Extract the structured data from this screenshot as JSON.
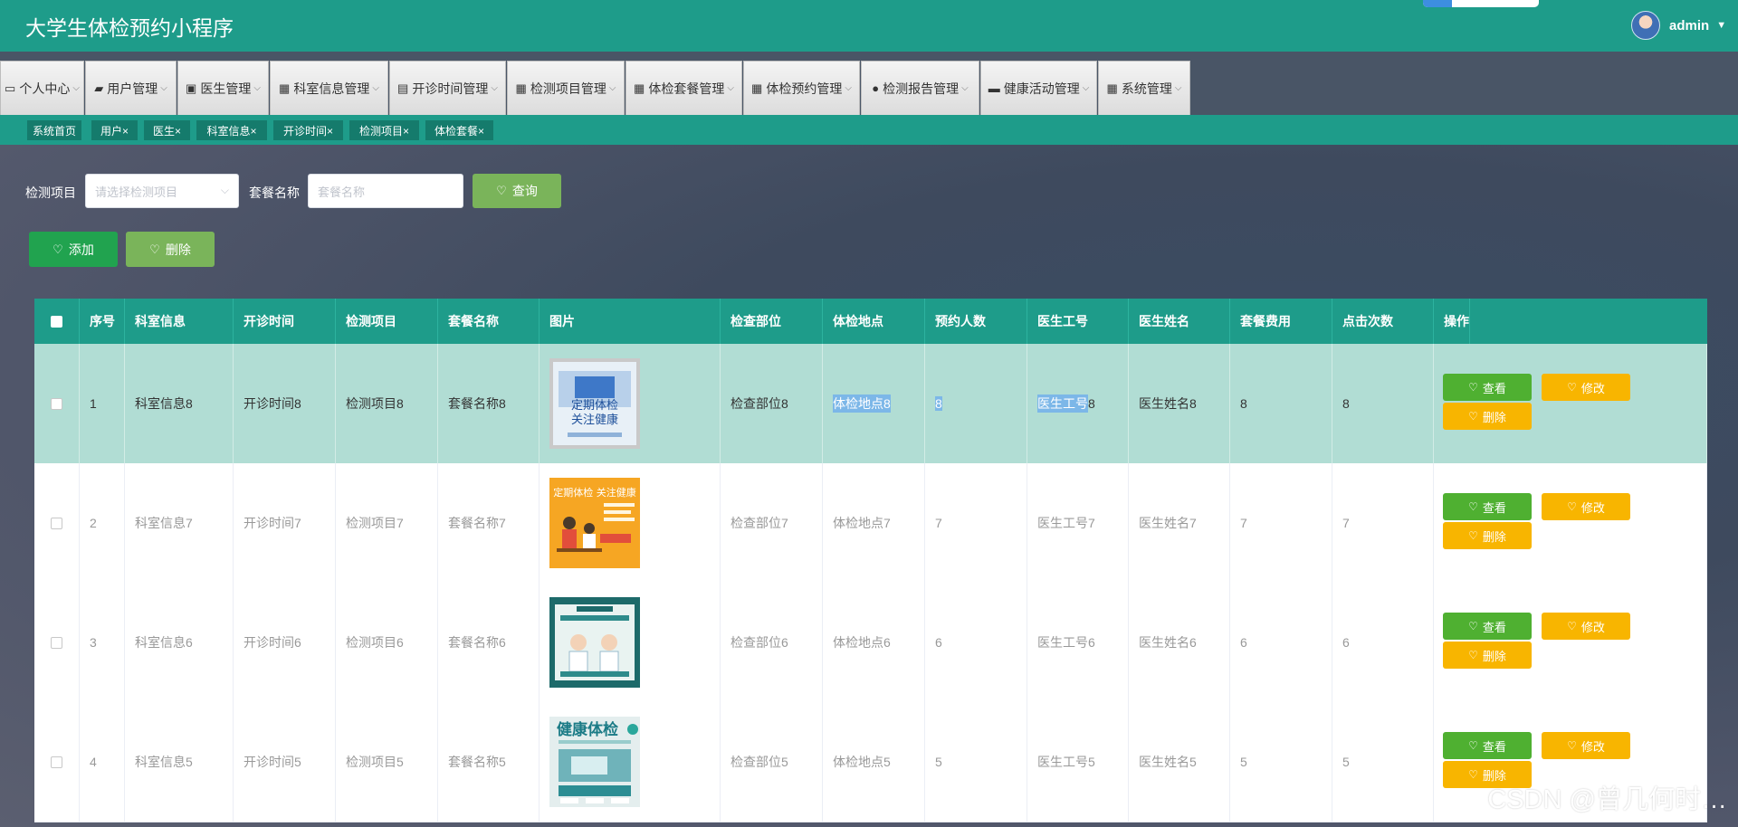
{
  "app": {
    "title": "大学生体检预约小程序",
    "progress_fraction": 0.25
  },
  "user": {
    "name": "admin",
    "avatar_icon": "user-avatar",
    "caret_icon": "caret-down-icon"
  },
  "menu": [
    {
      "label": "个人中心",
      "icon": "monitor-icon",
      "glyph": "▭"
    },
    {
      "label": "用户管理",
      "icon": "pin-icon",
      "glyph": "▰"
    },
    {
      "label": "医生管理",
      "icon": "clipboard-icon",
      "glyph": "▣"
    },
    {
      "label": "科室信息管理",
      "icon": "grid-icon",
      "glyph": "▦"
    },
    {
      "label": "开诊时间管理",
      "icon": "comment-icon",
      "glyph": "▤"
    },
    {
      "label": "检测项目管理",
      "icon": "grid-icon",
      "glyph": "▦"
    },
    {
      "label": "体检套餐管理",
      "icon": "grid-icon",
      "glyph": "▦"
    },
    {
      "label": "体检预约管理",
      "icon": "grid-icon",
      "glyph": "▦"
    },
    {
      "label": "检测报告管理",
      "icon": "user-icon",
      "glyph": "●"
    },
    {
      "label": "健康活动管理",
      "icon": "drive-icon",
      "glyph": "▬"
    },
    {
      "label": "系统管理",
      "icon": "grid-icon",
      "glyph": "▦"
    }
  ],
  "tags": [
    "系统首页",
    "用户×",
    "医生×",
    "科室信息×",
    "开诊时间×",
    "检测项目×",
    "体检套餐×"
  ],
  "filter": {
    "item_label": "检测项目",
    "item_placeholder": "请选择检测项目",
    "name_label": "套餐名称",
    "name_placeholder": "套餐名称",
    "query_label": "查询"
  },
  "actions": {
    "add_label": "添加",
    "delete_label": "删除"
  },
  "table": {
    "headers": [
      "序号",
      "科室信息",
      "开诊时间",
      "检测项目",
      "套餐名称",
      "图片",
      "检查部位",
      "体检地点",
      "预约人数",
      "医生工号",
      "医生姓名",
      "套餐费用",
      "点击次数",
      "操作"
    ],
    "rows": [
      {
        "no": "1",
        "dept": "科室信息8",
        "time": "开诊时间8",
        "item": "检测项目8",
        "pkg": "套餐名称8",
        "image": "poster: 定期体检 关注健康",
        "part": "检查部位8",
        "place": "体检地点8",
        "count": "8",
        "doc_id": "医生工号8",
        "doc_name": "医生姓名8",
        "fee": "8",
        "clicks": "8"
      },
      {
        "no": "2",
        "dept": "科室信息7",
        "time": "开诊时间7",
        "item": "检测项目7",
        "pkg": "套餐名称7",
        "image": "poster: 定期体检 关注健康 (orange)",
        "part": "检查部位7",
        "place": "体检地点7",
        "count": "7",
        "doc_id": "医生工号7",
        "doc_name": "医生姓名7",
        "fee": "7",
        "clicks": "7"
      },
      {
        "no": "3",
        "dept": "科室信息6",
        "time": "开诊时间6",
        "item": "检测项目6",
        "pkg": "套餐名称6",
        "image": "poster: doctors teal",
        "part": "检查部位6",
        "place": "体检地点6",
        "count": "6",
        "doc_id": "医生工号6",
        "doc_name": "医生姓名6",
        "fee": "6",
        "clicks": "6"
      },
      {
        "no": "4",
        "dept": "科室信息5",
        "time": "开诊时间5",
        "item": "检测项目5",
        "pkg": "套餐名称5",
        "image": "poster: 健康体检",
        "part": "检查部位5",
        "place": "体检地点5",
        "count": "5",
        "doc_id": "医生工号5",
        "doc_name": "医生姓名5",
        "fee": "5",
        "clicks": "5"
      }
    ],
    "row_actions": {
      "view": "查看",
      "edit": "修改",
      "delete": "删除"
    }
  },
  "watermark": "CSDN @曾几何时…",
  "colors": {
    "primary": "#1e9c8a",
    "tag": "#157b6c",
    "view": "#4fb031",
    "edit": "#f8b500",
    "add": "#21a34f",
    "delete": "#7ab45a",
    "query": "#7ab45a",
    "selected_row": "#b1ddd4"
  }
}
